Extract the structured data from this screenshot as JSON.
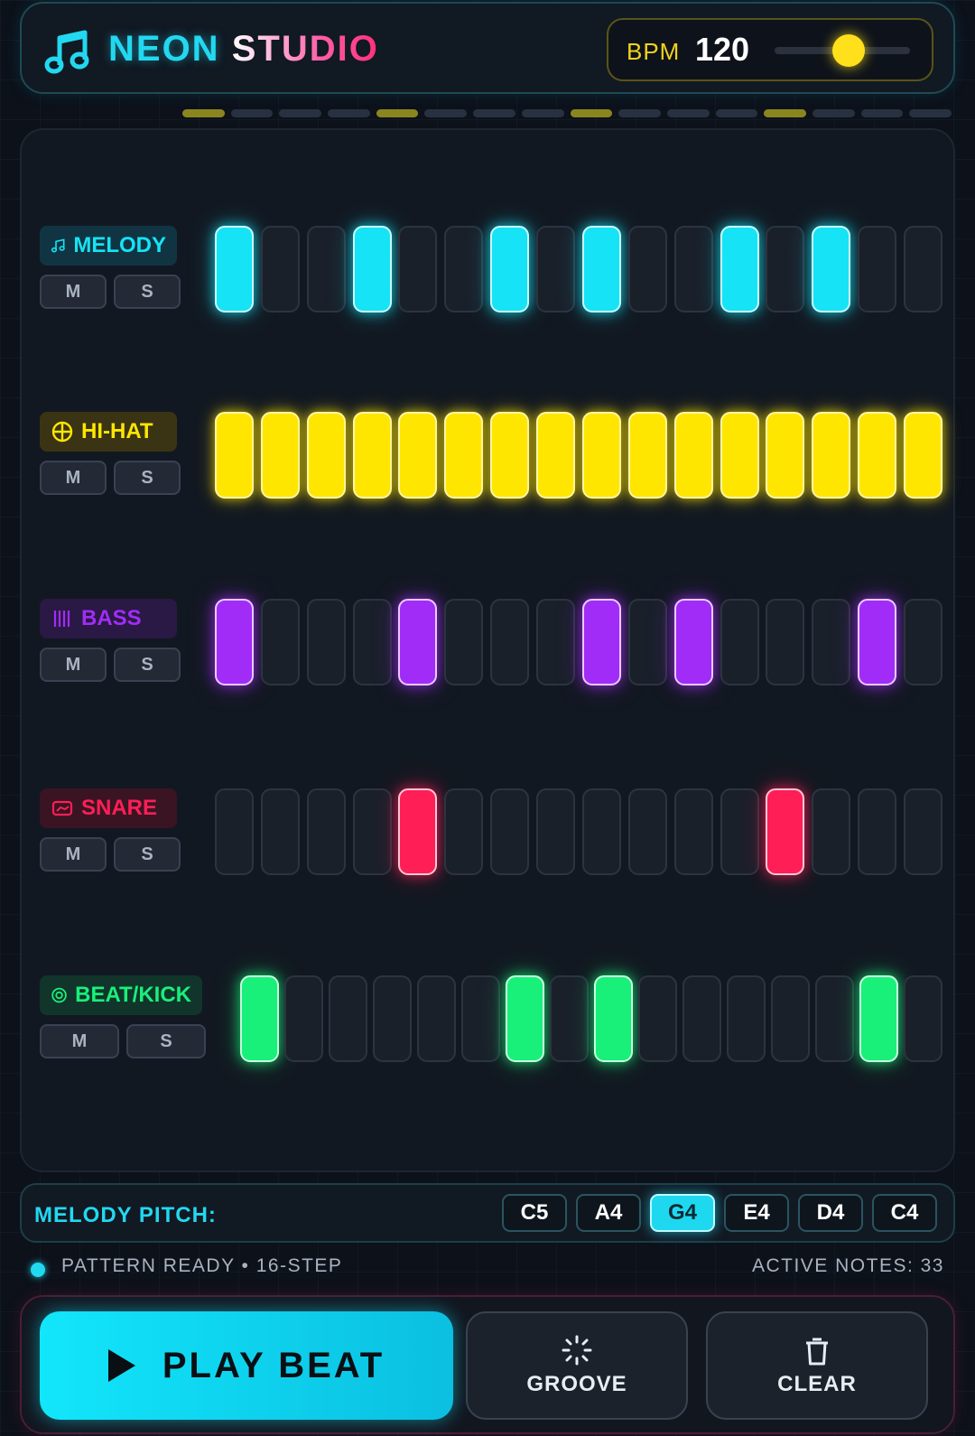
{
  "app": {
    "brand_first": "NEON",
    "brand_second": "STUDIO"
  },
  "bpm": {
    "label": "BPM",
    "value": "120",
    "slider_fraction": 0.45
  },
  "playhead": {
    "steps": 16,
    "highlighted_steps": [
      0,
      4,
      8,
      12
    ]
  },
  "tracks": [
    {
      "name": "MELODY",
      "icon": "music-note-icon",
      "color": "#16e3f5",
      "mute_label": "M",
      "solo_label": "S",
      "pattern": [
        1,
        0,
        0,
        1,
        0,
        0,
        1,
        0,
        1,
        0,
        0,
        1,
        0,
        1,
        0,
        0
      ]
    },
    {
      "name": "HI-HAT",
      "icon": "crosshair-circle-icon",
      "color": "#ffe600",
      "mute_label": "M",
      "solo_label": "S",
      "pattern": [
        1,
        1,
        1,
        1,
        1,
        1,
        1,
        1,
        1,
        1,
        1,
        1,
        1,
        1,
        1,
        1
      ]
    },
    {
      "name": "BASS",
      "icon": "bars-icon",
      "color": "#a12cf7",
      "mute_label": "M",
      "solo_label": "S",
      "pattern": [
        1,
        0,
        0,
        0,
        1,
        0,
        0,
        0,
        1,
        0,
        1,
        0,
        0,
        0,
        1,
        0
      ]
    },
    {
      "name": "SNARE",
      "icon": "drum-box-icon",
      "color": "#ff1e56",
      "mute_label": "M",
      "solo_label": "S",
      "pattern": [
        0,
        0,
        0,
        0,
        1,
        0,
        0,
        0,
        0,
        0,
        0,
        0,
        1,
        0,
        0,
        0
      ]
    },
    {
      "name": "BEAT/KICK",
      "icon": "target-icon",
      "color": "#18f07a",
      "mute_label": "M",
      "solo_label": "S",
      "pattern": [
        1,
        0,
        0,
        0,
        0,
        0,
        1,
        0,
        1,
        0,
        0,
        0,
        0,
        0,
        1,
        0
      ]
    }
  ],
  "pitch": {
    "label": "MELODY PITCH:",
    "options": [
      "C5",
      "A4",
      "G4",
      "E4",
      "D4",
      "C4"
    ],
    "selected": "G4"
  },
  "status": {
    "left": "PATTERN READY • 16-STEP",
    "right": "ACTIVE NOTES: 33"
  },
  "controls": {
    "play_label": "PLAY BEAT",
    "groove_label": "GROOVE",
    "clear_label": "CLEAR"
  }
}
